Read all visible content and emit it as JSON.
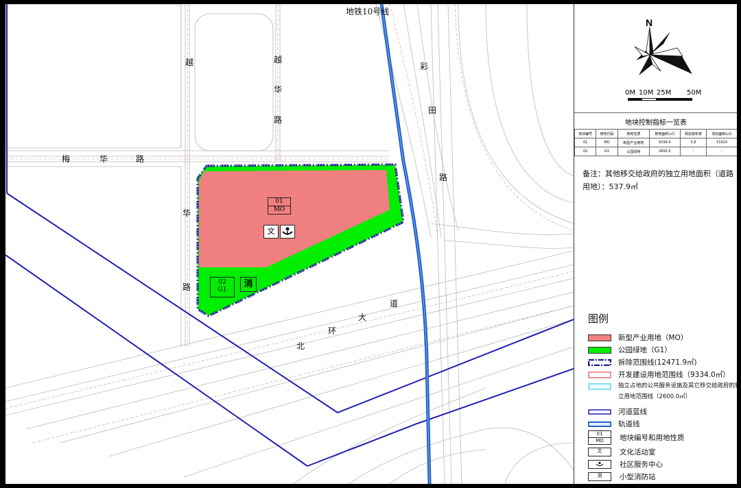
{
  "map": {
    "metro_label": "地铁10号线",
    "roads": {
      "yuehua": [
        "越",
        "华",
        "路"
      ],
      "caitian": [
        "彩",
        "田",
        "路"
      ],
      "meihua": [
        "梅",
        "华",
        "路"
      ],
      "hua_lu": [
        "华",
        "路"
      ],
      "beihuan": [
        "北",
        "环",
        "大",
        "道"
      ]
    },
    "parcel_01": {
      "code": "01",
      "use": "MO"
    },
    "parcel_02": {
      "code": "02",
      "use": "G1"
    },
    "icon_culture": "文",
    "icon_fire": "消",
    "colors": {
      "mo": "#F08080",
      "g1": "#00F000",
      "river": "#1F1FB0",
      "metro": "#1E5FC8",
      "demolition": "#1A1A8C"
    }
  },
  "compass": {
    "north": "N"
  },
  "scale": [
    "0M",
    "10M",
    "25M",
    "50M"
  ],
  "table": {
    "title": "地块控制指标一览表",
    "headers": [
      "地块编号",
      "用地代码",
      "用地性质",
      "用地面积(㎡)",
      "规划容积率",
      "规划面积(㎡)"
    ],
    "rows": [
      [
        "01",
        "MO",
        "新型产业用地",
        "9334.0",
        "5.8",
        "51610"
      ],
      [
        "02",
        "G1",
        "公园绿地",
        "2600.0",
        "-",
        "-"
      ]
    ]
  },
  "note": "备注：其他移交给政府的独立用地面积（道路用地）：537.9㎡",
  "legend": {
    "title": "图例",
    "items": [
      "新型产业用地（MO）",
      "公园绿地（G1）",
      "拆除范围线(12471.9㎡)",
      "开发建设用地范围线（9334.0㎡）",
      "独立占地的公共服务设施及其它移交给政府的独立用地范围线（2600.0㎡）",
      "河道蓝线",
      "轨道线",
      "地块编号和用地性质",
      "文化活动室",
      "社区服务中心",
      "小型消防站"
    ],
    "sym_parcel": [
      "01",
      "MO"
    ],
    "sym_culture": "文",
    "sym_fire": "消"
  }
}
